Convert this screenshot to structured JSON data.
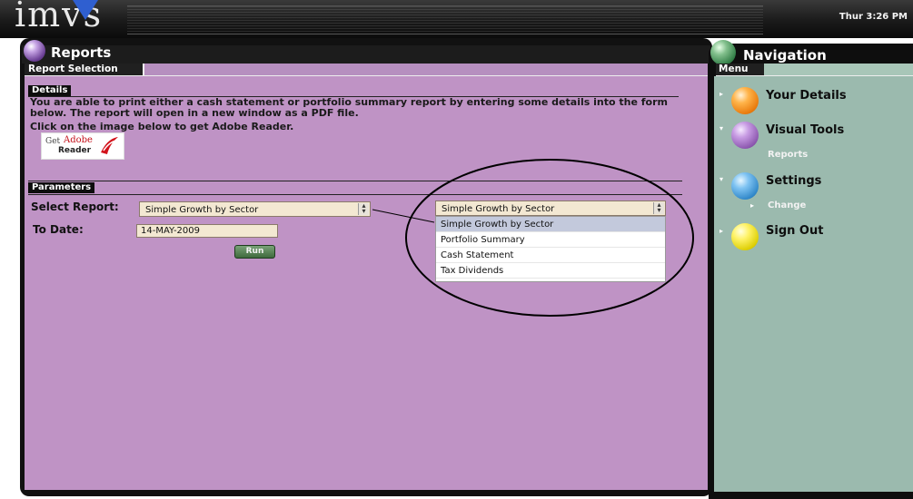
{
  "app": {
    "logo_text": "imvs",
    "clock": "Thur 3:26 PM"
  },
  "reports": {
    "title": "Reports",
    "tab": "Report Selection",
    "details_heading": "Details",
    "details_text": "You are able to print either a cash statement or portfolio summary report by entering some details into the form below. The report will open in a new window as a PDF file.",
    "adobe_note": "Click on the image below to get Adobe Reader.",
    "adobe_badge": {
      "get": "Get",
      "brand": "Adobe",
      "product": "Reader"
    },
    "parameters_heading": "Parameters",
    "select_report_label": "Select Report:",
    "select_report_value": "Simple Growth by Sector",
    "to_date_label": "To Date:",
    "to_date_value": "14-MAY-2009",
    "run_label": "Run"
  },
  "zoom_dropdown": {
    "value": "Simple Growth by Sector",
    "options": [
      "Simple Growth by Sector",
      "Portfolio Summary",
      "Cash Statement",
      "Tax Dividends"
    ],
    "selected_index": 0
  },
  "navigation": {
    "title": "Navigation",
    "menu_tag": "Menu",
    "items": [
      {
        "label": "Your Details",
        "color": "#ff8c1a"
      },
      {
        "label": "Visual Tools",
        "color": "#a06bc0",
        "sub": "Reports"
      },
      {
        "label": "Settings",
        "color": "#3a8fd8",
        "sub": "Change"
      },
      {
        "label": "Sign Out",
        "color": "#f0e21a"
      }
    ]
  },
  "colors": {
    "content_bg": "#bf93c5",
    "nav_bg": "#9bbaae",
    "annotation_stroke": "#000000"
  }
}
